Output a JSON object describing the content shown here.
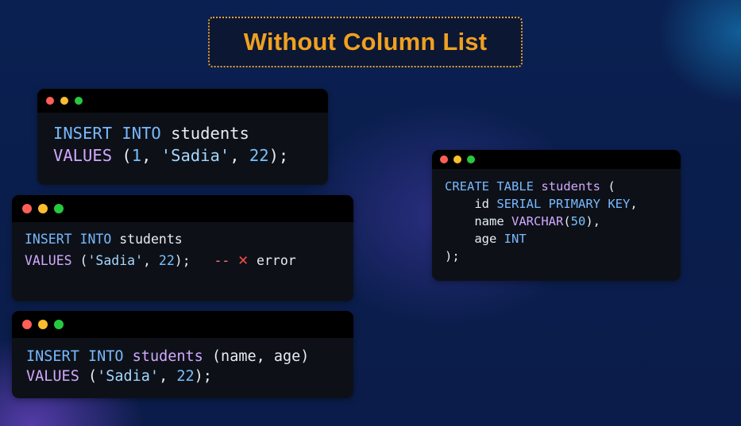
{
  "title": "Without Column List",
  "window1": {
    "line1": {
      "kw1": "INSERT",
      "kw2": "INTO",
      "table": "students"
    },
    "line2": {
      "kw": "VALUES",
      "p1": "(",
      "n1": "1",
      "c1": ", ",
      "s1": "'Sadia'",
      "c2": ", ",
      "n2": "22",
      "end": ");"
    }
  },
  "window2": {
    "line1": {
      "kw1": "INSERT",
      "kw2": "INTO",
      "table": "students"
    },
    "line2": {
      "kw": "VALUES",
      "p1": "(",
      "s1": "'Sadia'",
      "c1": ", ",
      "n1": "22",
      "end": ");",
      "comment": "--",
      "x_icon": "✕",
      "error": "error"
    }
  },
  "window3": {
    "line1": {
      "kw1": "INSERT",
      "kw2": "INTO",
      "table": "students",
      "cols": "(name, age)"
    },
    "line2": {
      "kw": "VALUES",
      "p1": "(",
      "s1": "'Sadia'",
      "c1": ", ",
      "n1": "22",
      "end": ");"
    }
  },
  "window4": {
    "line1": {
      "kw1": "CREATE",
      "kw2": "TABLE",
      "table": "students",
      "open": "("
    },
    "line2": {
      "col": "id",
      "type": "SERIAL PRIMARY KEY",
      "comma": ","
    },
    "line3": {
      "col": "name",
      "type": "VARCHAR",
      "p1": "(",
      "n": "50",
      "p2": "),"
    },
    "line4": {
      "col": "age",
      "type": "INT"
    },
    "line5": {
      "close": ");"
    }
  },
  "colors": {
    "title": "#f0a020",
    "keyword": "#79b8ff",
    "values_keyword": "#d2a8ff",
    "string": "#a5d6ff",
    "error": "#ff4b4b"
  }
}
